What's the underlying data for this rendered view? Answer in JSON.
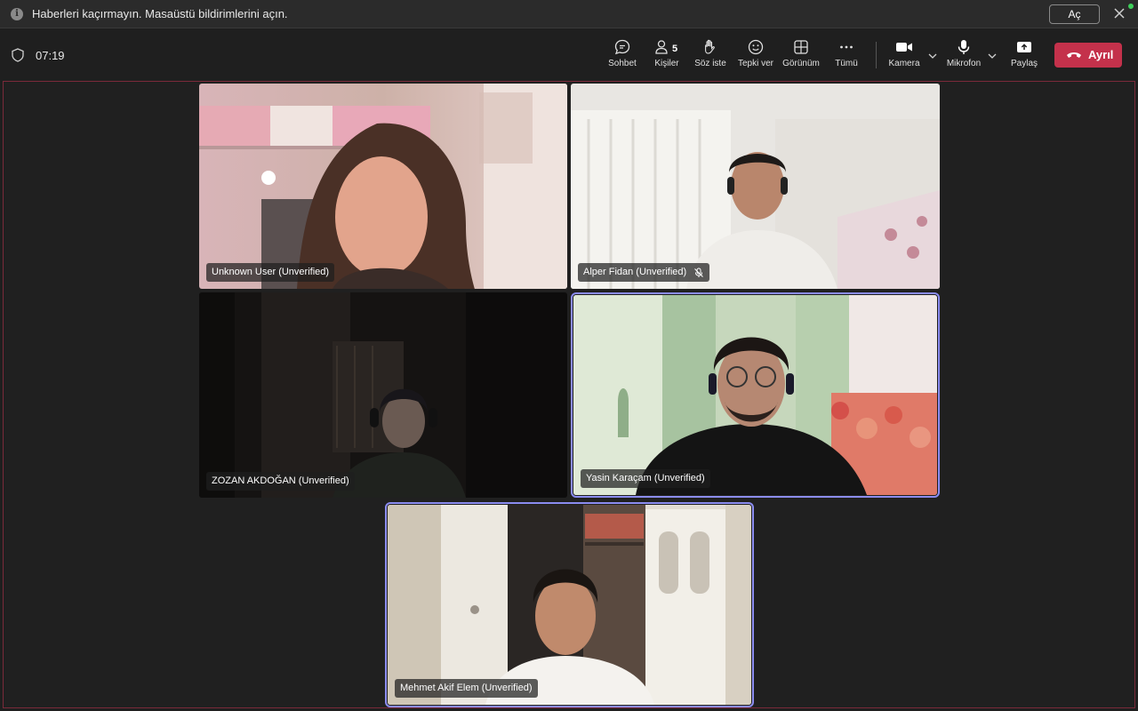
{
  "notification": {
    "text": "Haberleri kaçırmayın. Masaüstü bildirimlerini açın.",
    "action_label": "Aç"
  },
  "toolbar": {
    "timer": "07:19",
    "chat_label": "Sohbet",
    "people_label": "Kişiler",
    "people_count": "5",
    "raise_hand_label": "Söz iste",
    "react_label": "Tepki ver",
    "view_label": "Görünüm",
    "more_label": "Tümü",
    "camera_label": "Kamera",
    "mic_label": "Mikrofon",
    "share_label": "Paylaş",
    "leave_label": "Ayrıl"
  },
  "participants": [
    {
      "name": "Unknown User (Unverified)",
      "muted": false,
      "active": false
    },
    {
      "name": "Alper Fidan (Unverified)",
      "muted": true,
      "active": false
    },
    {
      "name": "ZOZAN AKDOĞAN (Unverified)",
      "muted": false,
      "active": false
    },
    {
      "name": "Yasin Karaçam (Unverified)",
      "muted": false,
      "active": true
    },
    {
      "name": "Mehmet Akif Elem (Unverified)",
      "muted": false,
      "active": true
    }
  ],
  "colors": {
    "leave": "#c4314b",
    "active_speaker": "#8b8cf0",
    "stage_border": "#7a2a3a"
  }
}
